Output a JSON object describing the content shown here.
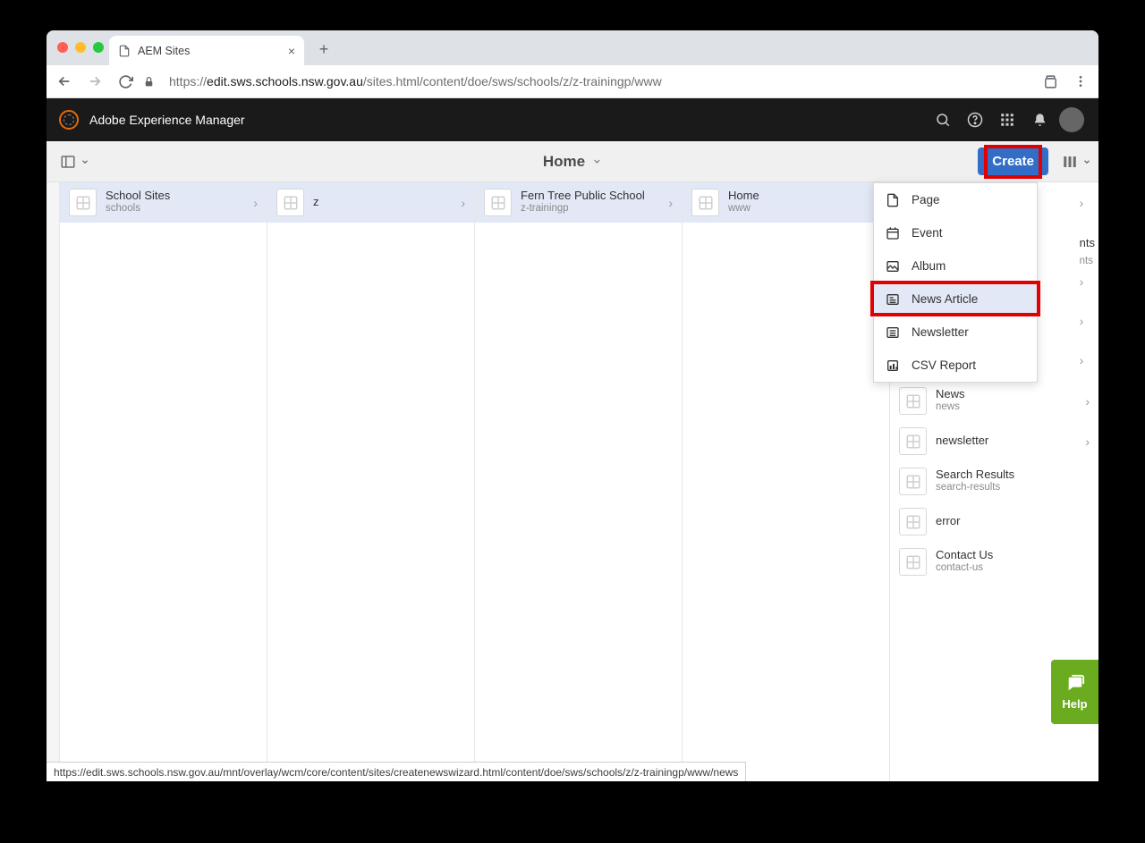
{
  "browser": {
    "tab_title": "AEM Sites",
    "url_prefix": "https://",
    "url_host": "edit.sws.schools.nsw.gov.au",
    "url_path": "/sites.html/content/doe/sws/schools/z/z-trainingp/www",
    "status_url": "https://edit.sws.schools.nsw.gov.au/mnt/overlay/wcm/core/content/sites/createnewswizard.html/content/doe/sws/schools/z/z-trainingp/www/news"
  },
  "header": {
    "brand": "Adobe Experience Manager"
  },
  "actionbar": {
    "breadcrumb": "Home",
    "create_label": "Create"
  },
  "columns": [
    {
      "items": [
        {
          "title": "School Sites",
          "sub": "schools",
          "selected": true
        }
      ]
    },
    {
      "items": [
        {
          "title": "z",
          "sub": "",
          "selected": true
        }
      ]
    },
    {
      "items": [
        {
          "title": "Fern Tree Public School",
          "sub": "z-trainingp",
          "selected": true
        }
      ]
    },
    {
      "items": [
        {
          "title": "Home",
          "sub": "www",
          "selected": true
        }
      ]
    },
    {
      "items": [
        {
          "title": "",
          "sub": "",
          "trailing": "nts"
        },
        {
          "title": "",
          "sub": "",
          "trailing_sub": "nts"
        },
        {
          "title": "News",
          "sub": "news"
        },
        {
          "title": "newsletter",
          "sub": ""
        },
        {
          "title": "Search Results",
          "sub": "search-results"
        },
        {
          "title": "error",
          "sub": ""
        },
        {
          "title": "Contact Us",
          "sub": "contact-us"
        }
      ]
    }
  ],
  "create_menu": {
    "items": [
      {
        "label": "Page",
        "icon": "page"
      },
      {
        "label": "Event",
        "icon": "calendar"
      },
      {
        "label": "Album",
        "icon": "image"
      },
      {
        "label": "News Article",
        "icon": "news",
        "hover": true
      },
      {
        "label": "Newsletter",
        "icon": "list"
      },
      {
        "label": "CSV Report",
        "icon": "report"
      }
    ]
  },
  "help": {
    "label": "Help"
  }
}
